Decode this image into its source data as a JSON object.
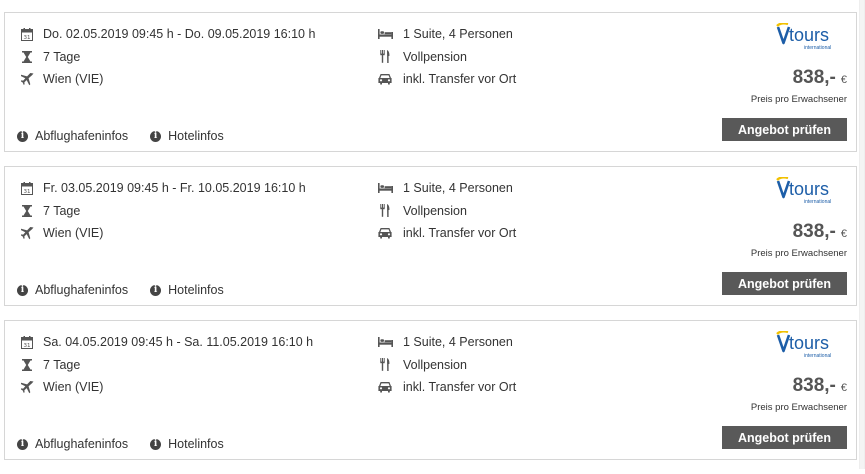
{
  "offers": [
    {
      "date_range": "Do. 02.05.2019 09:45 h - Do. 09.05.2019 16:10 h",
      "duration": "7 Tage",
      "departure": "Wien (VIE)",
      "room": "1 Suite, 4 Personen",
      "board": "Vollpension",
      "transfer": "inkl. Transfer vor Ort",
      "price": "838,-",
      "currency": "€",
      "price_note": "Preis pro Erwachsener",
      "button": "Angebot prüfen",
      "link_airport": "Abflughafeninfos",
      "link_hotel": "Hotelinfos"
    },
    {
      "date_range": "Fr. 03.05.2019 09:45 h - Fr. 10.05.2019 16:10 h",
      "duration": "7 Tage",
      "departure": "Wien (VIE)",
      "room": "1 Suite, 4 Personen",
      "board": "Vollpension",
      "transfer": "inkl. Transfer vor Ort",
      "price": "838,-",
      "currency": "€",
      "price_note": "Preis pro Erwachsener",
      "button": "Angebot prüfen",
      "link_airport": "Abflughafeninfos",
      "link_hotel": "Hotelinfos"
    },
    {
      "date_range": "Sa. 04.05.2019 09:45 h - Sa. 11.05.2019 16:10 h",
      "duration": "7 Tage",
      "departure": "Wien (VIE)",
      "room": "1 Suite, 4 Personen",
      "board": "Vollpension",
      "transfer": "inkl. Transfer vor Ort",
      "price": "838,-",
      "currency": "€",
      "price_note": "Preis pro Erwachsener",
      "button": "Angebot prüfen",
      "link_airport": "Abflughafeninfos",
      "link_hotel": "Hotelinfos"
    }
  ],
  "brand": {
    "logo_text": "tours",
    "logo_sub": "international",
    "colors": {
      "blue": "#1d5ea8",
      "yellow": "#f2c100",
      "button": "#595959"
    }
  },
  "icons": {
    "calendar_day": "31",
    "date": "calendar-icon",
    "duration": "hourglass-icon",
    "departure": "airplane-icon",
    "room": "bed-icon",
    "board": "cutlery-icon",
    "transfer": "car-icon",
    "info": "info-icon"
  }
}
